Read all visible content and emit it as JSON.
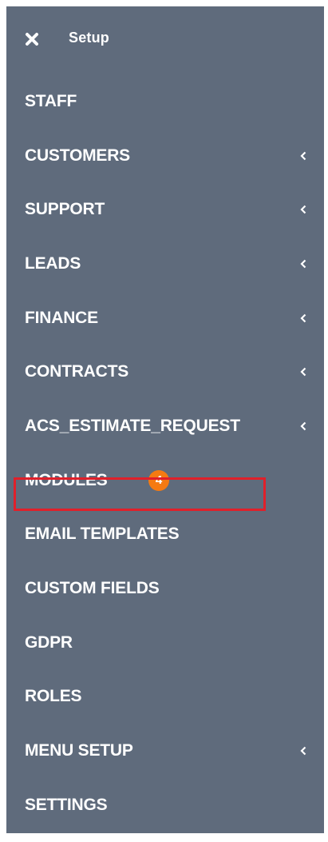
{
  "header": {
    "title": "Setup",
    "close_icon": "close-icon"
  },
  "menu": {
    "items": [
      {
        "label": "STAFF",
        "has_submenu": false
      },
      {
        "label": "CUSTOMERS",
        "has_submenu": true
      },
      {
        "label": "SUPPORT",
        "has_submenu": true
      },
      {
        "label": "LEADS",
        "has_submenu": true
      },
      {
        "label": "FINANCE",
        "has_submenu": true
      },
      {
        "label": "CONTRACTS",
        "has_submenu": true
      },
      {
        "label": "ACS_ESTIMATE_REQUEST",
        "has_submenu": true
      },
      {
        "label": "MODULES",
        "has_submenu": false,
        "badge": "4",
        "highlighted": true
      },
      {
        "label": "EMAIL TEMPLATES",
        "has_submenu": false
      },
      {
        "label": "CUSTOM FIELDS",
        "has_submenu": false
      },
      {
        "label": "GDPR",
        "has_submenu": false
      },
      {
        "label": "ROLES",
        "has_submenu": false
      },
      {
        "label": "MENU SETUP",
        "has_submenu": true
      },
      {
        "label": "SETTINGS",
        "has_submenu": false
      }
    ]
  },
  "colors": {
    "sidebar_bg": "#5f6b7c",
    "text": "#ffffff",
    "badge_bg": "#f57a12",
    "highlight_border": "#e0202a"
  },
  "icons": {
    "submenu_indicator": "chevron-left-icon"
  }
}
